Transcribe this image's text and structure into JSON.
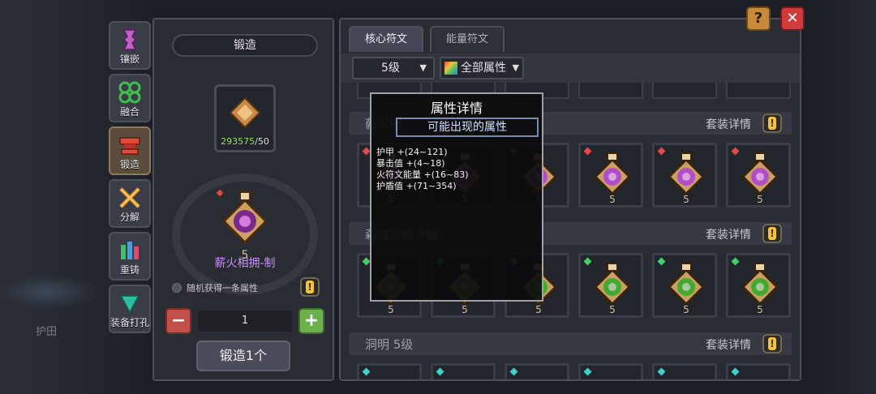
{
  "side_tools": [
    {
      "label": "镶嵌",
      "icon": "inlay-icon"
    },
    {
      "label": "融合",
      "icon": "fuse-icon"
    },
    {
      "label": "锻造",
      "icon": "forge-icon"
    },
    {
      "label": "分解",
      "icon": "decompose-icon"
    },
    {
      "label": "重铸",
      "icon": "recast-icon"
    },
    {
      "label": "装备打孔",
      "icon": "socket-icon"
    }
  ],
  "background": {
    "ghost_text": "护田"
  },
  "forge": {
    "title": "锻造",
    "material_have": "293575",
    "material_need": "/50",
    "result_name": "薪火相拥-制",
    "random_text": "随机获得一条属性",
    "quantity": "1",
    "minus_label": "−",
    "plus_label": "+",
    "forge_button": "锻造1个"
  },
  "tabs": [
    {
      "label": "核心符文",
      "active": true
    },
    {
      "label": "能量符文",
      "active": false
    }
  ],
  "filters": {
    "level": "5级",
    "attribute": "全部属性"
  },
  "sets": [
    {
      "name": "薪火相",
      "detail": "套装详情",
      "gem_color": "#e04a4a",
      "rune_color": "#b34cc9"
    },
    {
      "name": "森魂之触 5级",
      "detail": "套装详情",
      "gem_color": "#3fcf6a",
      "rune_color": "#43a92f"
    },
    {
      "name": "洞明 5级",
      "detail": "套装详情",
      "gem_color": "#3fd0c8",
      "rune_color": "#3fd0c8"
    }
  ],
  "popup": {
    "title": "属性详情",
    "subtitle": "可能出现的属性",
    "lines": [
      "护甲   +(24~121)",
      "暴击值   +(4~18)",
      "火符文能量   +(16~83)",
      "护盾值   +(71~354)"
    ]
  },
  "corner": {
    "help_label": "?",
    "close_label": "✕"
  }
}
